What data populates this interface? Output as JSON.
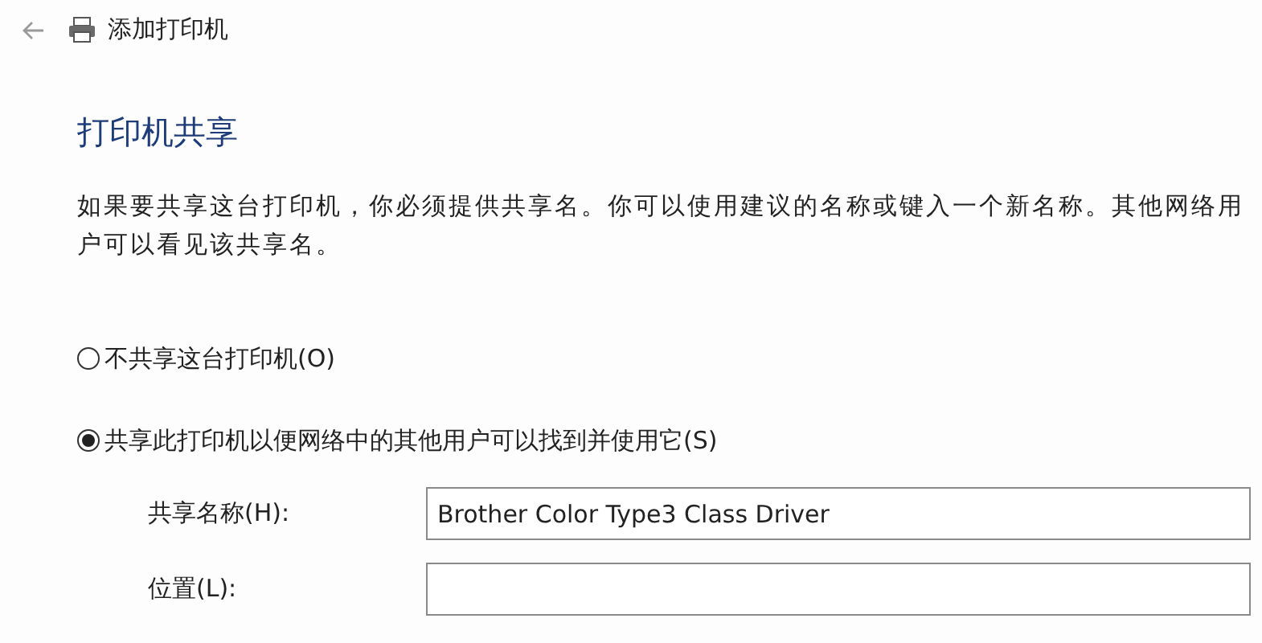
{
  "window": {
    "title": "添加打印机"
  },
  "heading": "打印机共享",
  "description": "如果要共享这台打印机，你必须提供共享名。你可以使用建议的名称或键入一个新名称。其他网络用户可以看见该共享名。",
  "options": [
    {
      "label": "不共享这台打印机(O)",
      "selected": false
    },
    {
      "label": "共享此打印机以便网络中的其他用户可以找到并使用它(S)",
      "selected": true
    }
  ],
  "fields": [
    {
      "label": "共享名称(H):",
      "value": "Brother Color Type3 Class Driver"
    },
    {
      "label": "位置(L):"
    }
  ]
}
